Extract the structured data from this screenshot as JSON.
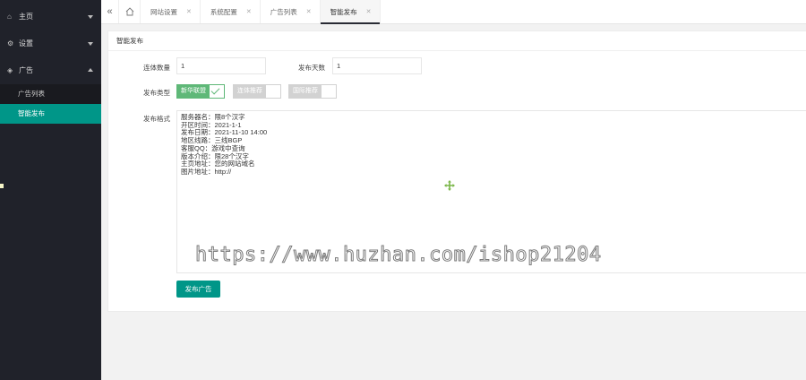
{
  "sidebar": {
    "items": [
      {
        "label": "主页",
        "icon": "home-icon"
      },
      {
        "label": "设置",
        "icon": "gear-icon"
      },
      {
        "label": "广告",
        "icon": "diamond-icon"
      }
    ],
    "ads_sub": [
      {
        "label": "广告列表"
      },
      {
        "label": "智能发布"
      }
    ]
  },
  "tabs": [
    {
      "label": "网站设置"
    },
    {
      "label": "系统配置"
    },
    {
      "label": "广告列表"
    },
    {
      "label": "智能发布"
    }
  ],
  "form": {
    "card_title": "智能发布",
    "count_label": "连体数量",
    "count_value": "1",
    "days_label": "发布天数",
    "days_value": "1",
    "type_label": "发布类型",
    "type_options": [
      {
        "label": "新华联盟",
        "checked": true
      },
      {
        "label": "连体推荐",
        "checked": false
      },
      {
        "label": "国际推荐",
        "checked": false
      }
    ],
    "format_label": "发布格式",
    "format_lines": [
      "服务器名：限8个汉字",
      "开区时间：2021-1-1",
      "发布日期：2021-11-10 14:00",
      "地区线路：三线BGP",
      "客服QQ：游戏中查询",
      "版本介绍：限28个汉字",
      "主页地址：您的网站域名",
      "图片地址：http://"
    ],
    "submit_label": "发布广告"
  },
  "watermark": "https://www.huzhan.com/ishop21204",
  "colors": {
    "sidebar_bg": "#20222a",
    "accent": "#009688",
    "checkbox_on": "#5fb878"
  }
}
